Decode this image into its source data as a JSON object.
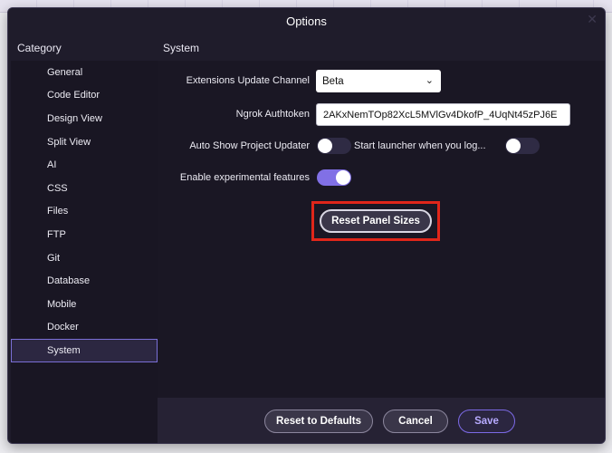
{
  "dialog": {
    "title": "Options",
    "close_icon": "close-icon",
    "category_header": "Category",
    "section_header": "System"
  },
  "sidebar": {
    "items": [
      {
        "label": "General"
      },
      {
        "label": "Code Editor"
      },
      {
        "label": "Design View"
      },
      {
        "label": "Split View"
      },
      {
        "label": "AI"
      },
      {
        "label": "CSS"
      },
      {
        "label": "Files"
      },
      {
        "label": "FTP"
      },
      {
        "label": "Git"
      },
      {
        "label": "Database"
      },
      {
        "label": "Mobile"
      },
      {
        "label": "Docker"
      },
      {
        "label": "System"
      }
    ],
    "selected": "System"
  },
  "system": {
    "update_channel_label": "Extensions Update Channel",
    "update_channel_value": "Beta",
    "ngrok_label": "Ngrok Authtoken",
    "ngrok_value": "2AKxNemTOp82XcL5MVlGv4DkofP_4UqNt45zPJ6E",
    "auto_show_label": "Auto Show Project Updater",
    "auto_show_on": false,
    "start_launcher_label": "Start launcher when you log...",
    "start_launcher_on": false,
    "experimental_label": "Enable experimental features",
    "experimental_on": true,
    "reset_panels_label": "Reset Panel Sizes"
  },
  "footer": {
    "reset_defaults_label": "Reset to Defaults",
    "cancel_label": "Cancel",
    "save_label": "Save"
  },
  "colors": {
    "accent": "#8170e6",
    "highlight": "#e0261a",
    "dialog_bg": "#1f1c2b"
  }
}
